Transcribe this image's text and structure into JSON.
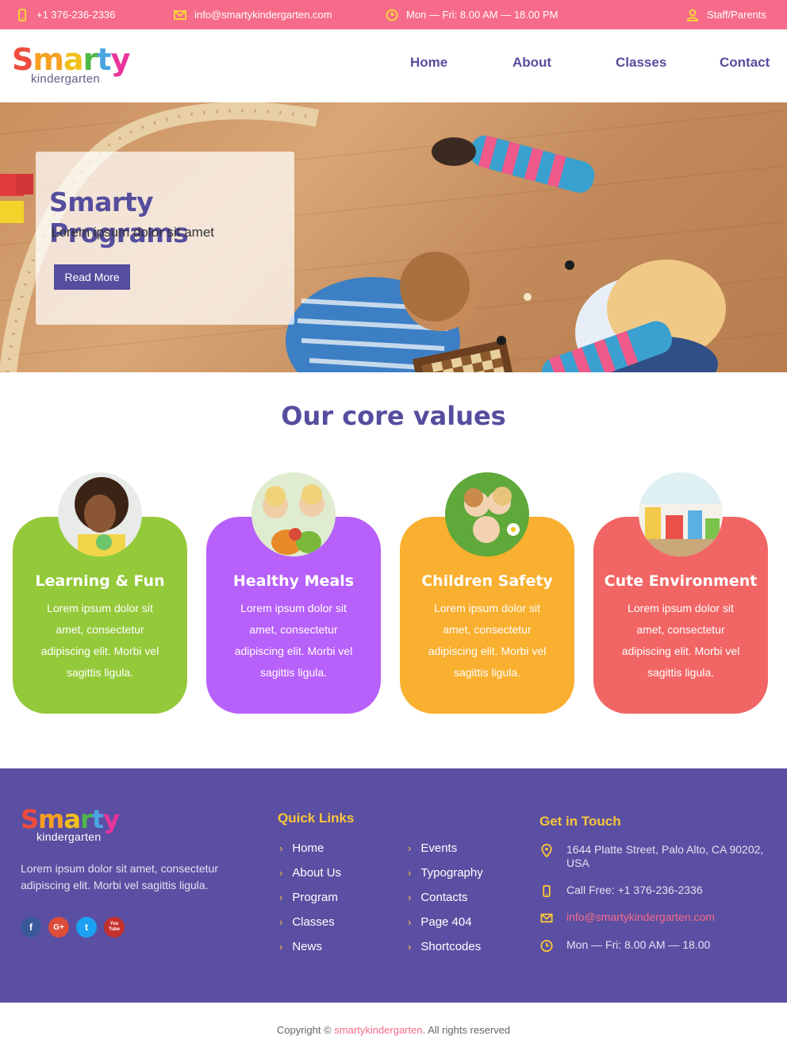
{
  "topbar": {
    "phone": "+1 376-236-2336",
    "email": "info@smartykindergarten.com",
    "hours": "Mon — Fri: 8.00 AM — 18.00 PM",
    "staff": "Staff/Parents"
  },
  "logo": {
    "letters": [
      "S",
      "m",
      "a",
      "r",
      "t",
      "y"
    ],
    "colors": [
      "#ef4c3e",
      "#f7a021",
      "#f2c01a",
      "#4fb848",
      "#4aa5e0",
      "#e8349b"
    ],
    "sub": "kindergarten"
  },
  "nav": {
    "home": "Home",
    "about": "About",
    "classes": "Classes",
    "contact": "Contact"
  },
  "hero": {
    "title": "Smarty Programs",
    "subtitle": "Lorem ipsum dolor sit amet",
    "button": "Read More"
  },
  "values": {
    "title": "Our core values",
    "cards": [
      {
        "title": "Learning & Fun",
        "text": "Lorem ipsum dolor sit amet, consectetur adipiscing elit. Morbi vel sagittis ligula.",
        "color": "#94c93a"
      },
      {
        "title": "Healthy Meals",
        "text": "Lorem ipsum dolor sit amet, consectetur adipiscing elit. Morbi vel sagittis ligula.",
        "color": "#b760fa"
      },
      {
        "title": "Children Safety",
        "text": "Lorem ipsum dolor sit amet, consectetur adipiscing elit. Morbi vel sagittis ligula.",
        "color": "#f9af2f"
      },
      {
        "title": "Cute Environment",
        "text": "Lorem ipsum dolor sit amet, consectetur adipiscing elit. Morbi vel sagittis ligula.",
        "color": "#f26565"
      }
    ]
  },
  "footer": {
    "about": "Lorem ipsum dolor sit amet, consectetur adipiscing elit. Morbi vel sagittis ligula.",
    "socials": [
      "f",
      "G+",
      "t",
      "You Tube"
    ],
    "quick_links_title": "Quick Links",
    "links_col1": [
      "Home",
      "About Us",
      "Program",
      "Classes",
      "News"
    ],
    "links_col2": [
      "Events",
      "Typography",
      "Contacts",
      "Page 404",
      "Shortcodes"
    ],
    "contact_title": "Get in Touch",
    "address": "1644 Platte Street, Palo Alto, CA 90202, USA",
    "phone": "Call Free: +1 376-236-2336",
    "email": "info@smartykindergarten.com",
    "hours": "Mon — Fri: 8.00 AM — 18.00"
  },
  "copyright": {
    "prefix": "Copyright © ",
    "site": "smartykindergarten",
    "suffix": ". All rights reserved"
  }
}
